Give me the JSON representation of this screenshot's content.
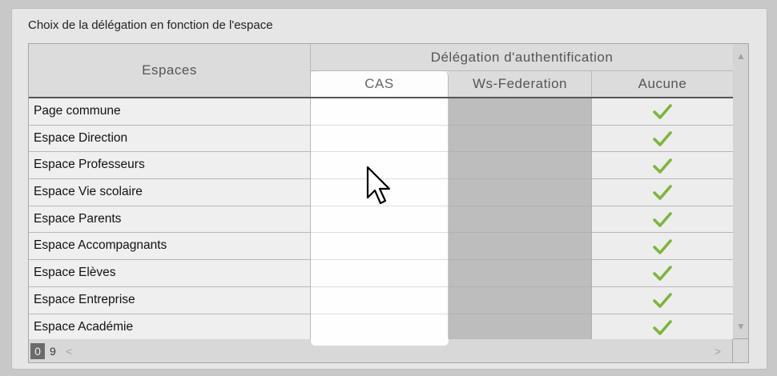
{
  "panel": {
    "title": "Choix de la délégation en fonction de l'espace"
  },
  "table": {
    "header_espaces": "Espaces",
    "header_group": "Délégation d'authentification",
    "columns": [
      "CAS",
      "Ws-Federation",
      "Aucune"
    ],
    "rows": [
      {
        "name": "Page commune",
        "selected": "Aucune"
      },
      {
        "name": "Espace Direction",
        "selected": "Aucune"
      },
      {
        "name": "Espace Professeurs",
        "selected": "Aucune"
      },
      {
        "name": "Espace Vie scolaire",
        "selected": "Aucune"
      },
      {
        "name": "Espace Parents",
        "selected": "Aucune"
      },
      {
        "name": "Espace Accompagnants",
        "selected": "Aucune"
      },
      {
        "name": "Espace Elèves",
        "selected": "Aucune"
      },
      {
        "name": "Espace Entreprise",
        "selected": "Aucune"
      },
      {
        "name": "Espace Académie",
        "selected": "Aucune"
      }
    ]
  },
  "footer": {
    "frozen_count": "0",
    "total_count": "9"
  },
  "colors": {
    "check": "#7cb63a",
    "ws_column_disabled": "#bdbdbd",
    "cas_column_highlight": "#fefefe"
  },
  "icons": {
    "check": "check-icon",
    "cursor": "mouse-pointer-icon",
    "scroll_up": "chevron-up-icon",
    "scroll_down": "chevron-down-icon",
    "scroll_left": "chevron-left-icon",
    "scroll_right": "chevron-right-icon"
  }
}
